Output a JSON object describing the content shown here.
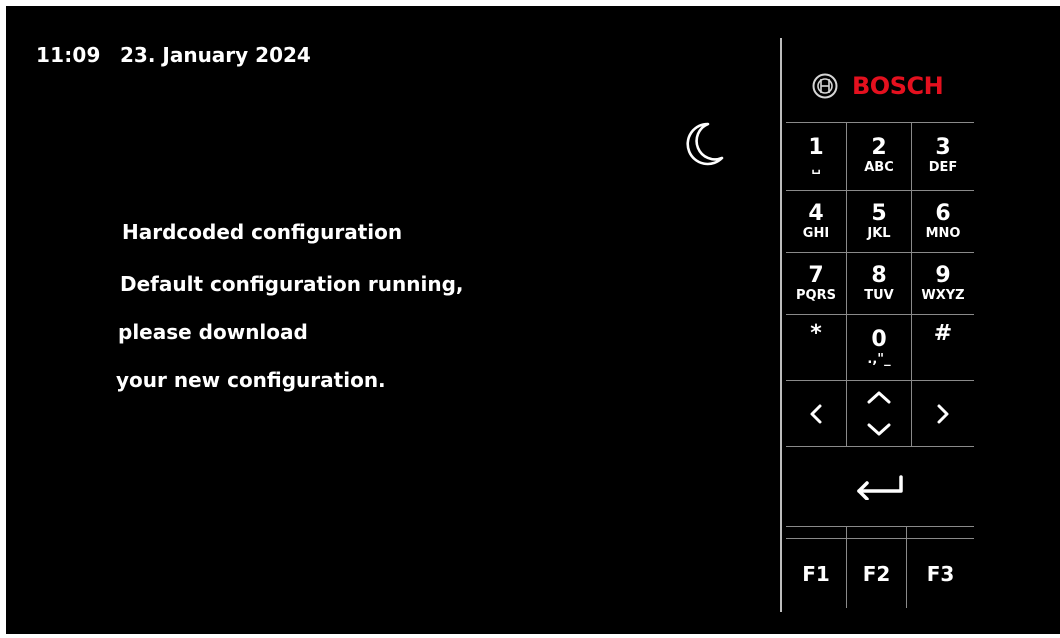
{
  "status": {
    "time": "11:09",
    "date": "23. January 2024"
  },
  "icons": {
    "night_mode": "moon-icon"
  },
  "message": {
    "line1": "Hardcoded configuration",
    "line2": "Default configuration running,",
    "line3": "please download",
    "line4": "your new configuration."
  },
  "brand": {
    "name": "BOSCH",
    "color": "#e4101e"
  },
  "keypad": {
    "keys": [
      {
        "digit": "1",
        "letters": "␣"
      },
      {
        "digit": "2",
        "letters": "ABC"
      },
      {
        "digit": "3",
        "letters": "DEF"
      },
      {
        "digit": "4",
        "letters": "GHI"
      },
      {
        "digit": "5",
        "letters": "JKL"
      },
      {
        "digit": "6",
        "letters": "MNO"
      },
      {
        "digit": "7",
        "letters": "PQRS"
      },
      {
        "digit": "8",
        "letters": "TUV"
      },
      {
        "digit": "9",
        "letters": "WXYZ"
      },
      {
        "digit": "*",
        "letters": ""
      },
      {
        "digit": "0",
        "letters": ".,\"_"
      },
      {
        "digit": "#",
        "letters": ""
      }
    ],
    "nav": {
      "left": "<",
      "up": "^",
      "down": "v",
      "right": ">"
    },
    "enter_icon": "enter-arrow-icon",
    "function_keys": [
      "F1",
      "F2",
      "F3"
    ]
  }
}
